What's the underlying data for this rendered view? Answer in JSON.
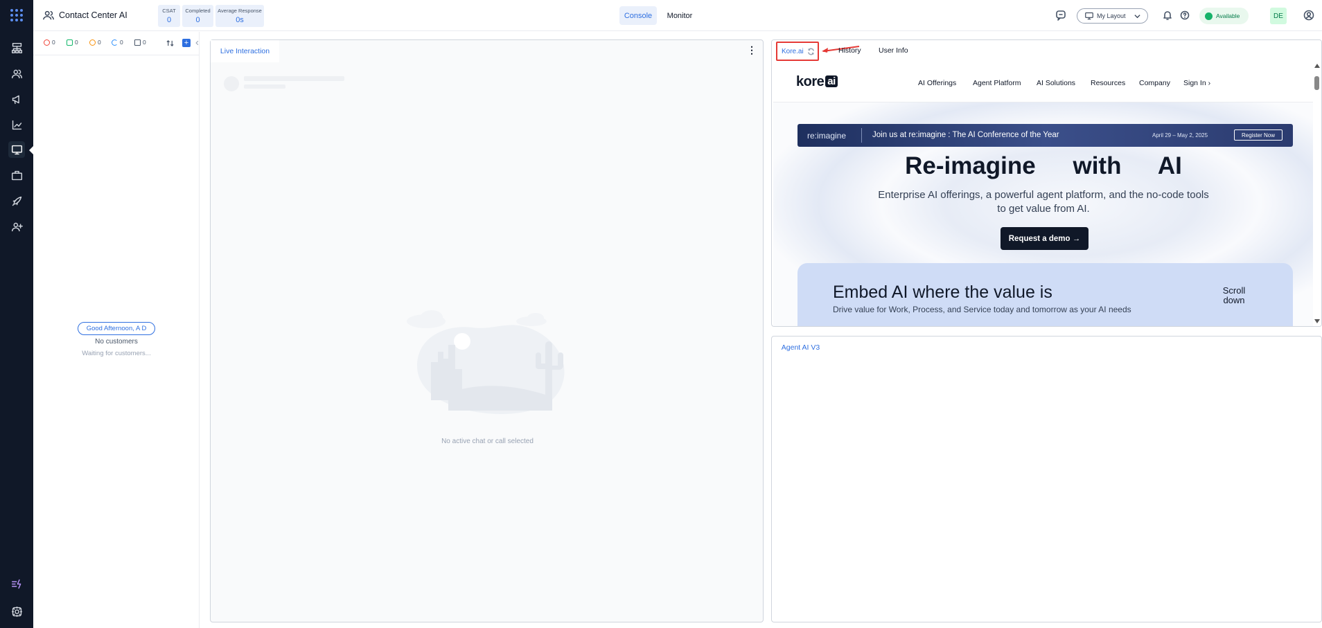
{
  "app": {
    "title": "Contact Center AI"
  },
  "stats": [
    {
      "label": "CSAT",
      "value": "0"
    },
    {
      "label": "Completed",
      "value": "0"
    },
    {
      "label": "Average Response",
      "value": "0s"
    }
  ],
  "nav": {
    "console": "Console",
    "monitor": "Monitor"
  },
  "toolbar": {
    "layout_label": "My Layout",
    "status_label": "Available",
    "avatar_initials": "DE"
  },
  "filters": [
    {
      "icon": "alert-icon",
      "count": "0",
      "color": "#f04438"
    },
    {
      "icon": "transfer-icon",
      "count": "0",
      "color": "#12b76a"
    },
    {
      "icon": "clock-icon",
      "count": "0",
      "color": "#f79009"
    },
    {
      "icon": "moon-icon",
      "count": "0",
      "color": "#2e90fa"
    },
    {
      "icon": "note-icon",
      "count": "0",
      "color": "#475467"
    }
  ],
  "left_panel": {
    "greeting": "Good Afternoon, A D",
    "no_customers": "No customers",
    "waiting": "Waiting for customers..."
  },
  "center": {
    "tab": "Live Interaction",
    "empty_text": "No active chat or call selected"
  },
  "browser": {
    "tabs": {
      "kore": "Kore.ai",
      "history": "History",
      "user_info": "User Info"
    },
    "site": {
      "logo_text": "kore",
      "logo_badge": "ai",
      "nav": [
        "AI Offerings",
        "Agent Platform",
        "AI Solutions",
        "Resources",
        "Company",
        "Sign In"
      ],
      "banner": {
        "brand": "re:imagine",
        "text": "Join us at re:imagine : The AI Conference of the Year",
        "date": "April 29 – May 2, 2025",
        "cta": "Register Now"
      },
      "hero_title": "Re-imagine with AI",
      "hero_sub": "Enterprise AI offerings, a powerful agent platform, and the no-code tools to get value from AI.",
      "hero_cta": "Request a demo →",
      "embed_title": "Embed AI where the value is",
      "embed_sub": "Drive value for Work, Process, and Service today and tomorrow as your AI needs",
      "scroll_down": "Scroll down"
    }
  },
  "agent_panel": {
    "tab": "Agent AI V3"
  },
  "colors": {
    "accent": "#2e6fe0",
    "rail": "#101828",
    "highlight": "#e53935",
    "available": "#17b26a"
  }
}
